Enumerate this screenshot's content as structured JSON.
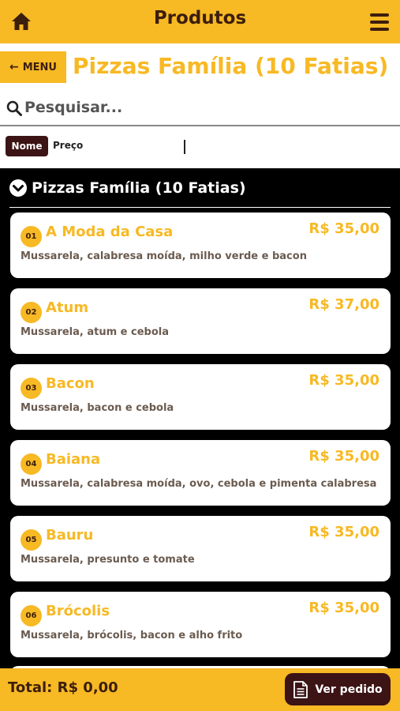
{
  "header": {
    "title": "Produtos",
    "home_icon": "home-icon",
    "menu_icon": "hamburger-icon"
  },
  "nav": {
    "back_label": "MENU",
    "category_title": "Pizzas Família (10 Fatias)"
  },
  "search": {
    "placeholder": "Pesquisar...",
    "value": ""
  },
  "sort": {
    "options": [
      "Nome",
      "Preço"
    ],
    "selected": "Nome"
  },
  "section": {
    "title": "Pizzas Família (10 Fatias)"
  },
  "products": [
    {
      "num": "01",
      "name": "A Moda da Casa",
      "price": "R$ 35,00",
      "desc": "Mussarela, calabresa moída, milho verde e bacon"
    },
    {
      "num": "02",
      "name": "Atum",
      "price": "R$ 37,00",
      "desc": "Mussarela, atum e cebola"
    },
    {
      "num": "03",
      "name": "Bacon",
      "price": "R$ 35,00",
      "desc": "Mussarela, bacon e cebola"
    },
    {
      "num": "04",
      "name": "Baiana",
      "price": "R$ 35,00",
      "desc": "Mussarela, calabresa moída, ovo, cebola e pimenta calabresa"
    },
    {
      "num": "05",
      "name": "Bauru",
      "price": "R$ 35,00",
      "desc": "Mussarela, presunto e tomate"
    },
    {
      "num": "06",
      "name": "Brócolis",
      "price": "R$ 35,00",
      "desc": "Mussarela, brócolis, bacon e alho frito"
    }
  ],
  "footer": {
    "total_label": "Total: R$ 0,00",
    "order_button": "Ver pedido"
  },
  "colors": {
    "brand_yellow": "#f7b924",
    "brand_brown": "#3c1416",
    "text_brown": "#3c1e0c"
  }
}
